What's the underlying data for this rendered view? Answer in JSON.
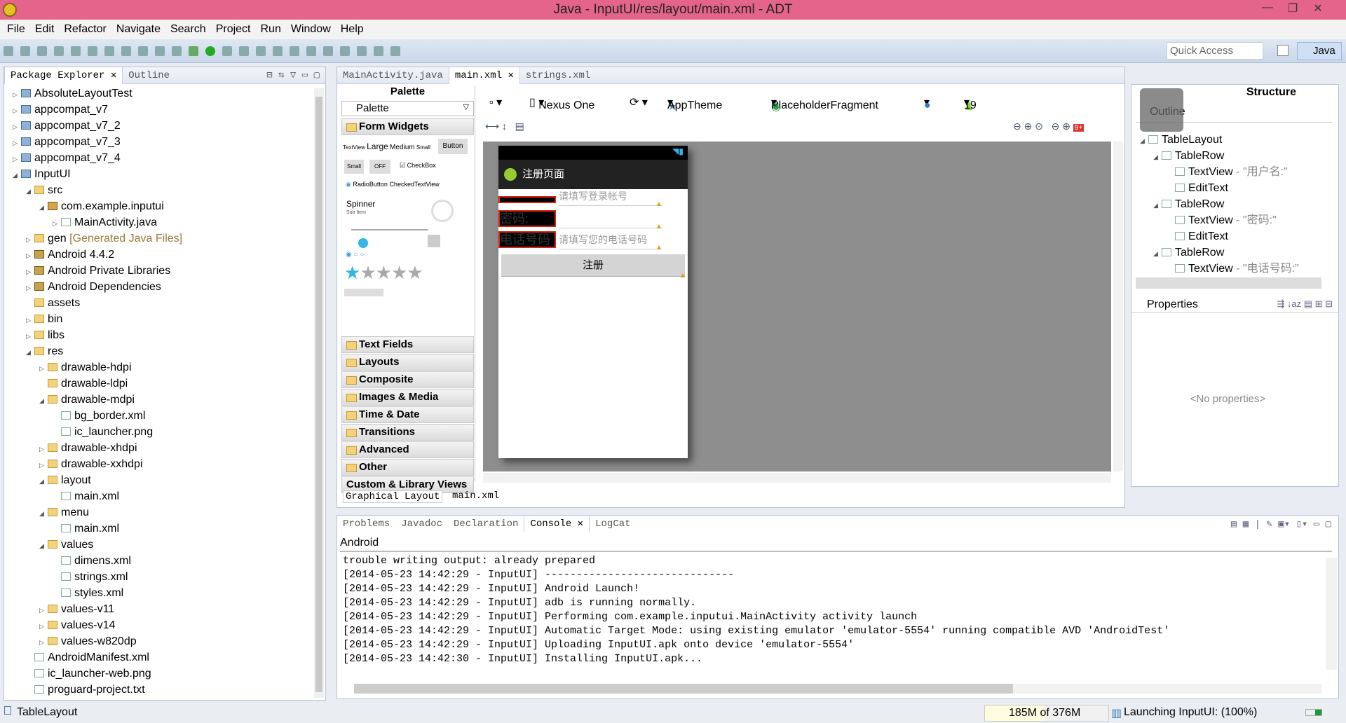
{
  "window": {
    "title": "Java - InputUI/res/layout/main.xml - ADT"
  },
  "menu": [
    "File",
    "Edit",
    "Refactor",
    "Navigate",
    "Search",
    "Project",
    "Run",
    "Window",
    "Help"
  ],
  "toolbar": {
    "quick_access_placeholder": "Quick Access",
    "perspective": "Java"
  },
  "package_explorer": {
    "tabs": [
      "Package Explorer",
      "Outline"
    ],
    "items": [
      {
        "label": "AbsoluteLayoutTest",
        "level": 0,
        "type": "proj",
        "tw": "▷"
      },
      {
        "label": "appcompat_v7",
        "level": 0,
        "type": "proj",
        "tw": "▷"
      },
      {
        "label": "appcompat_v7_2",
        "level": 0,
        "type": "proj",
        "tw": "▷"
      },
      {
        "label": "appcompat_v7_3",
        "level": 0,
        "type": "proj",
        "tw": "▷"
      },
      {
        "label": "appcompat_v7_4",
        "level": 0,
        "type": "proj",
        "tw": "▷"
      },
      {
        "label": "InputUI",
        "level": 0,
        "type": "proj",
        "tw": "◢"
      },
      {
        "label": "src",
        "level": 1,
        "type": "folder",
        "tw": "◢"
      },
      {
        "label": "com.example.inputui",
        "level": 2,
        "type": "pkgc",
        "tw": "◢"
      },
      {
        "label": "MainActivity.java",
        "level": 3,
        "type": "file",
        "tw": "▷"
      },
      {
        "label": "gen",
        "suffix": " [Generated Java Files]",
        "level": 1,
        "type": "folder",
        "tw": "▷"
      },
      {
        "label": "Android 4.4.2",
        "level": 1,
        "type": "lib",
        "tw": "▷"
      },
      {
        "label": "Android Private Libraries",
        "level": 1,
        "type": "lib",
        "tw": "▷"
      },
      {
        "label": "Android Dependencies",
        "level": 1,
        "type": "lib",
        "tw": "▷"
      },
      {
        "label": "assets",
        "level": 1,
        "type": "folder",
        "tw": ""
      },
      {
        "label": "bin",
        "level": 1,
        "type": "folder",
        "tw": "▷"
      },
      {
        "label": "libs",
        "level": 1,
        "type": "folder",
        "tw": "▷"
      },
      {
        "label": "res",
        "level": 1,
        "type": "folder",
        "tw": "◢"
      },
      {
        "label": "drawable-hdpi",
        "level": 2,
        "type": "folder",
        "tw": "▷"
      },
      {
        "label": "drawable-ldpi",
        "level": 2,
        "type": "folder",
        "tw": ""
      },
      {
        "label": "drawable-mdpi",
        "level": 2,
        "type": "folder",
        "tw": "◢"
      },
      {
        "label": "bg_border.xml",
        "level": 3,
        "type": "file",
        "tw": ""
      },
      {
        "label": "ic_launcher.png",
        "level": 3,
        "type": "file",
        "tw": ""
      },
      {
        "label": "drawable-xhdpi",
        "level": 2,
        "type": "folder",
        "tw": "▷"
      },
      {
        "label": "drawable-xxhdpi",
        "level": 2,
        "type": "folder",
        "tw": "▷"
      },
      {
        "label": "layout",
        "level": 2,
        "type": "folder",
        "tw": "◢"
      },
      {
        "label": "main.xml",
        "level": 3,
        "type": "file",
        "tw": ""
      },
      {
        "label": "menu",
        "level": 2,
        "type": "folder",
        "tw": "◢"
      },
      {
        "label": "main.xml",
        "level": 3,
        "type": "file",
        "tw": ""
      },
      {
        "label": "values",
        "level": 2,
        "type": "folder",
        "tw": "◢"
      },
      {
        "label": "dimens.xml",
        "level": 3,
        "type": "file",
        "tw": ""
      },
      {
        "label": "strings.xml",
        "level": 3,
        "type": "file",
        "tw": ""
      },
      {
        "label": "styles.xml",
        "level": 3,
        "type": "file",
        "tw": ""
      },
      {
        "label": "values-v11",
        "level": 2,
        "type": "folder",
        "tw": "▷"
      },
      {
        "label": "values-v14",
        "level": 2,
        "type": "folder",
        "tw": "▷"
      },
      {
        "label": "values-w820dp",
        "level": 2,
        "type": "folder",
        "tw": "▷"
      },
      {
        "label": "AndroidManifest.xml",
        "level": 1,
        "type": "file",
        "tw": ""
      },
      {
        "label": "ic_launcher-web.png",
        "level": 1,
        "type": "file",
        "tw": ""
      },
      {
        "label": "proguard-project.txt",
        "level": 1,
        "type": "file",
        "tw": ""
      }
    ]
  },
  "editor": {
    "tabs": [
      "MainActivity.java",
      "main.xml",
      "strings.xml"
    ],
    "active_tab": 1,
    "palette": {
      "title": "Palette",
      "dropdown": "Palette",
      "open_section": "Form Widgets",
      "widgets": {
        "textview": "TextView",
        "large": "Large",
        "medium": "Medium",
        "small": "Small",
        "button": "Button",
        "small_btn": "Small",
        "off": "OFF",
        "checkbox": "CheckBox",
        "radio": "RadioButton",
        "checked_tv": "CheckedTextView",
        "spinner": "Spinner",
        "sub_item": "Sub Item",
        "rating_stars": 5,
        "rating_value": 1
      },
      "sections": [
        "Text Fields",
        "Layouts",
        "Composite",
        "Images & Media",
        "Time & Date",
        "Transitions",
        "Advanced",
        "Other",
        "Custom & Library Views"
      ]
    },
    "config": {
      "device": "Nexus One",
      "theme": "AppTheme",
      "activity": "PlaceholderFragment",
      "api": "19"
    },
    "phone": {
      "app_title": "注册页面",
      "rows": [
        {
          "label": "用户名:",
          "hint": "请填写登录帐号"
        },
        {
          "label": "密码:",
          "hint": ""
        },
        {
          "label": "电话号码",
          "hint": "请填写您的电话号码"
        }
      ],
      "button": "注册"
    },
    "bottom_tabs": [
      "Graphical Layout",
      "main.xml"
    ]
  },
  "structure": {
    "title": "Structure",
    "outline_label": "Outline",
    "tree": [
      {
        "label": "TableLayout",
        "level": 0
      },
      {
        "label": "TableRow",
        "level": 1
      },
      {
        "label": "TextView",
        "detail": " - \"用户名:\"",
        "level": 2
      },
      {
        "label": "EditText",
        "level": 2
      },
      {
        "label": "TableRow",
        "level": 1
      },
      {
        "label": "TextView",
        "detail": " - \"密码:\"",
        "level": 2
      },
      {
        "label": "EditText",
        "level": 2
      },
      {
        "label": "TableRow",
        "level": 1
      },
      {
        "label": "TextView",
        "detail": " - \"电话号码:\"",
        "level": 2
      }
    ],
    "properties_title": "Properties",
    "no_properties": "<No properties>"
  },
  "console": {
    "tabs": [
      "Problems",
      "Javadoc",
      "Declaration",
      "Console",
      "LogCat"
    ],
    "active_tab": 3,
    "name": "Android",
    "lines": [
      "trouble writing output: already prepared",
      "[2014-05-23 14:42:29 - InputUI] ------------------------------",
      "[2014-05-23 14:42:29 - InputUI] Android Launch!",
      "[2014-05-23 14:42:29 - InputUI] adb is running normally.",
      "[2014-05-23 14:42:29 - InputUI] Performing com.example.inputui.MainActivity activity launch",
      "[2014-05-23 14:42:29 - InputUI] Automatic Target Mode: using existing emulator 'emulator-5554' running compatible AVD 'AndroidTest'",
      "[2014-05-23 14:42:29 - InputUI] Uploading InputUI.apk onto device 'emulator-5554'",
      "[2014-05-23 14:42:30 - InputUI] Installing InputUI.apk..."
    ]
  },
  "statusbar": {
    "selection": "TableLayout",
    "heap": "185M of 376M",
    "heap_used_fraction": 0.49,
    "progress": "Launching InputUI: (100%)"
  },
  "colors": {
    "titlebar": "#e4648c",
    "error_border": "#dd2211",
    "accent": "#33b5e5"
  }
}
